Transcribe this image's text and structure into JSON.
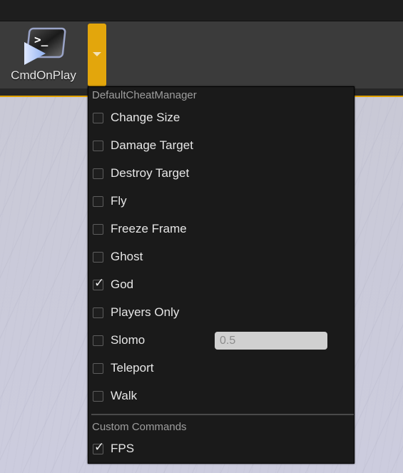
{
  "toolbar": {
    "button": {
      "label": "CmdOnPlay",
      "icon": "terminal-play-icon"
    },
    "dropdown": {
      "icon": "caret-down-icon",
      "accent_color": "#e3a60c"
    }
  },
  "menu": {
    "sections": [
      {
        "header": "DefaultCheatManager",
        "items": [
          {
            "label": "Change Size",
            "checked": false
          },
          {
            "label": "Damage Target",
            "checked": false
          },
          {
            "label": "Destroy Target",
            "checked": false
          },
          {
            "label": "Fly",
            "checked": false
          },
          {
            "label": "Freeze Frame",
            "checked": false
          },
          {
            "label": "Ghost",
            "checked": false
          },
          {
            "label": "God",
            "checked": true
          },
          {
            "label": "Players Only",
            "checked": false
          },
          {
            "label": "Slomo",
            "checked": false,
            "value": "0.5"
          },
          {
            "label": "Teleport",
            "checked": false
          },
          {
            "label": "Walk",
            "checked": false
          }
        ]
      },
      {
        "header": "Custom Commands",
        "items": [
          {
            "label": "FPS",
            "checked": true
          }
        ]
      }
    ],
    "check_glyph": "✓"
  }
}
